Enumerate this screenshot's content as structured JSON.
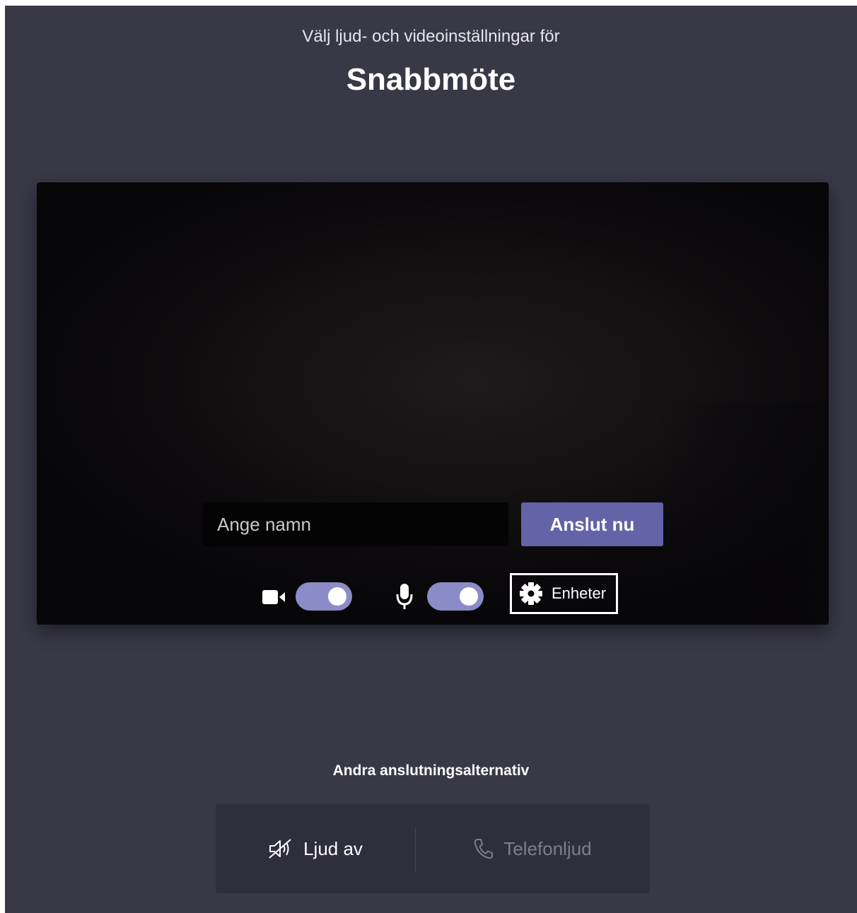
{
  "header": {
    "subtitle": "Välj ljud- och videoinställningar för",
    "meeting_title": "Snabbmöte"
  },
  "preview": {
    "name_input": {
      "value": "",
      "placeholder": "Ange namn"
    },
    "join_button_label": "Anslut nu",
    "controls": {
      "camera_icon": "video-camera-icon",
      "camera_toggle_on": true,
      "mic_icon": "microphone-icon",
      "mic_toggle_on": true,
      "devices_icon": "gear-icon",
      "devices_label": "Enheter"
    }
  },
  "other_options": {
    "heading": "Andra anslutningsalternativ",
    "items": [
      {
        "label": "Ljud av",
        "icon": "speaker-off-icon",
        "enabled": true
      },
      {
        "label": "Telefonljud",
        "icon": "phone-icon",
        "enabled": false
      }
    ]
  },
  "colors": {
    "background": "#393847",
    "accent": "#6264a7",
    "toggle_on": "#8b8cc7",
    "options_panel": "#2f2e3b",
    "disabled_text": "#7e7d8c"
  }
}
